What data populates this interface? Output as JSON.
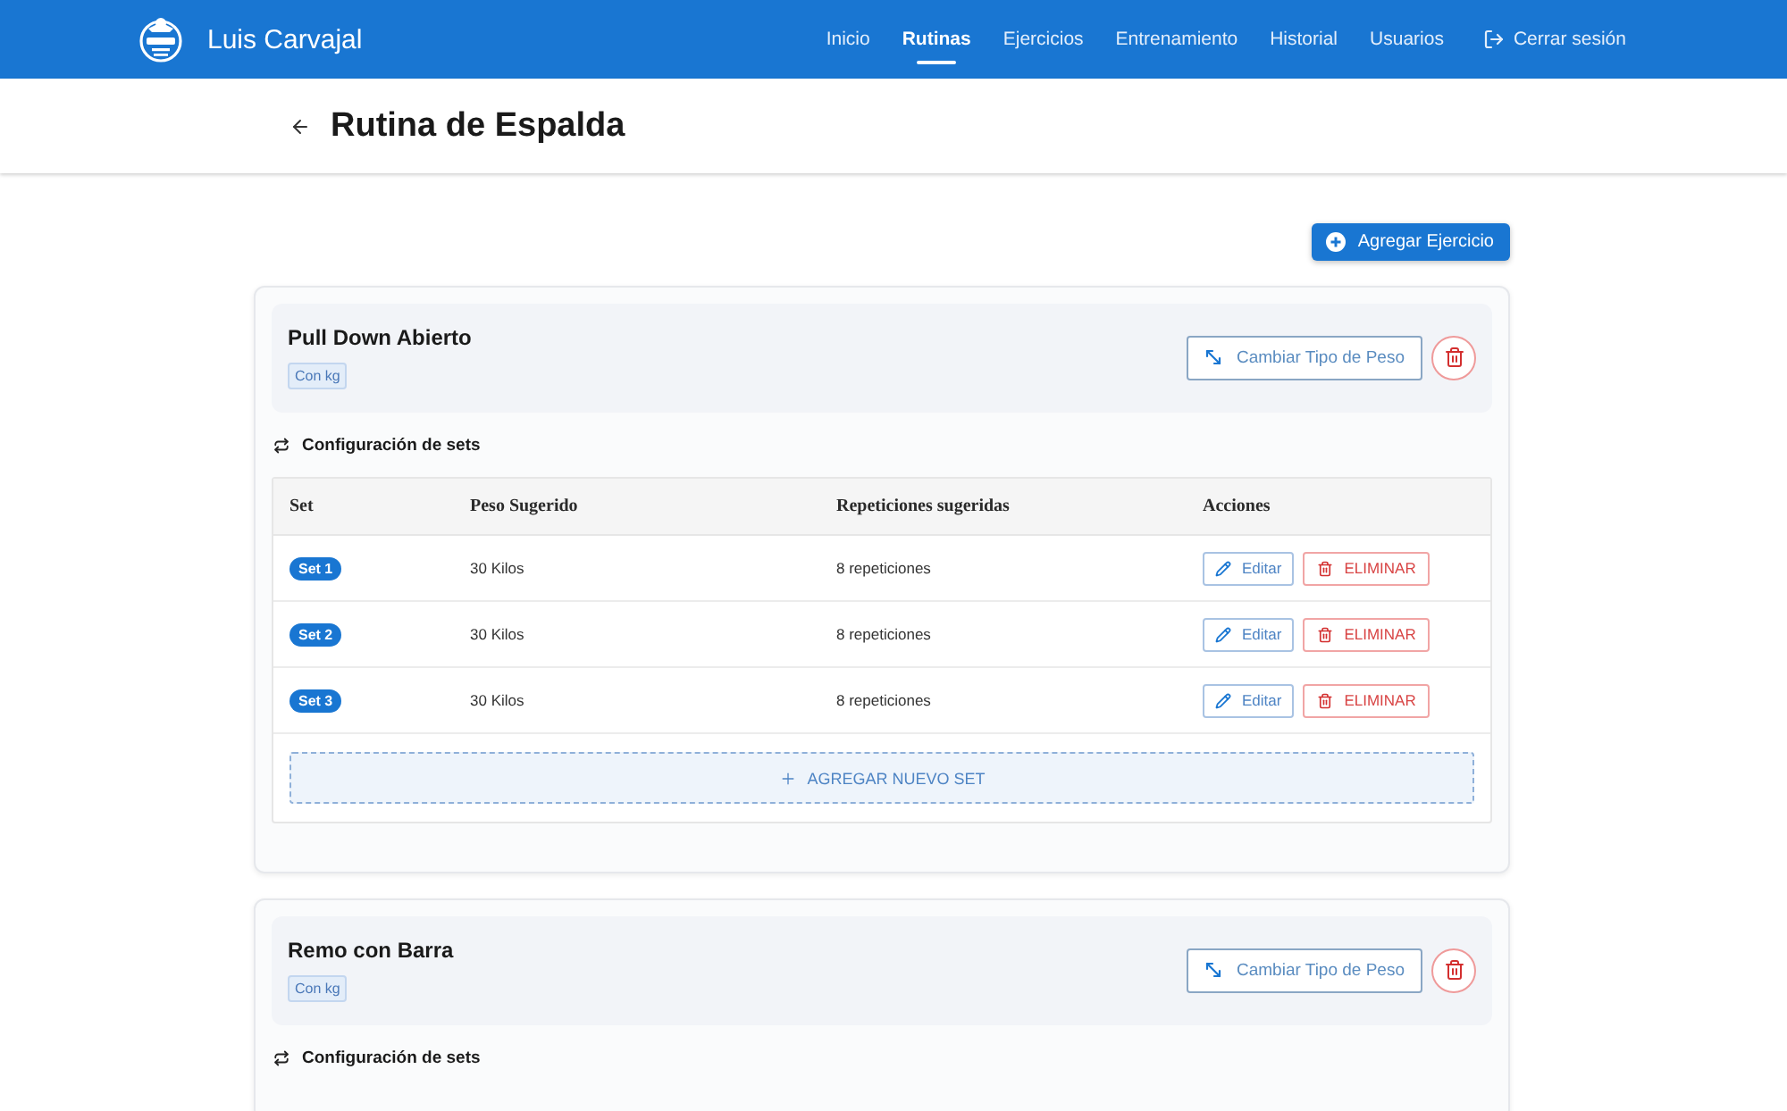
{
  "navbar": {
    "brand": "Luis Carvajal",
    "links": [
      {
        "label": "Inicio",
        "selected": false
      },
      {
        "label": "Rutinas",
        "selected": true
      },
      {
        "label": "Ejercicios",
        "selected": false
      },
      {
        "label": "Entrenamiento",
        "selected": false
      },
      {
        "label": "Historial",
        "selected": false
      },
      {
        "label": "Usuarios",
        "selected": false
      }
    ],
    "logout": "Cerrar sesión"
  },
  "header": {
    "title": "Rutina de Espalda"
  },
  "toolbar": {
    "add_button": "Agregar Ejercicio"
  },
  "exercises": [
    {
      "name": "Pull Down Abierto",
      "tag": "Con kg",
      "change_button": "Cambiar Tipo de Peso",
      "section_title": "Configuración de sets",
      "table": {
        "columns": [
          "Set",
          "Peso Sugerido",
          "Repeticiones sugeridas",
          "Acciones"
        ],
        "rows": [
          {
            "set": "Set 1",
            "weight": "30 Kilos",
            "reps": "8 repeticiones",
            "edit": "Editar",
            "delete": "ELIMINAR"
          },
          {
            "set": "Set 2",
            "weight": "30 Kilos",
            "reps": "8 repeticiones",
            "edit": "Editar",
            "delete": "ELIMINAR"
          },
          {
            "set": "Set 3",
            "weight": "30 Kilos",
            "reps": "8 repeticiones",
            "edit": "Editar",
            "delete": "ELIMINAR"
          }
        ],
        "add_set": "AGREGAR NUEVO SET"
      }
    },
    {
      "name": "Remo con Barra",
      "tag": "Con kg",
      "change_button": "Cambiar Tipo de Peso",
      "section_title": "Configuración de sets"
    }
  ]
}
